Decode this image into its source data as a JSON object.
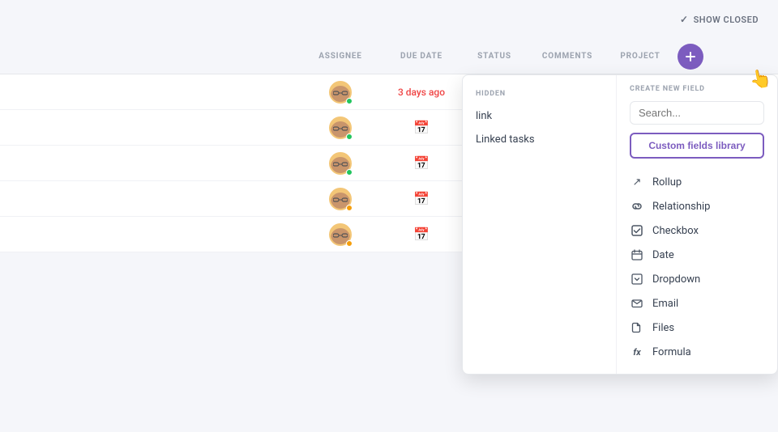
{
  "topbar": {
    "show_closed_label": "SHOW CLOSED"
  },
  "table": {
    "columns": {
      "assignee": "ASSIGNEE",
      "due_date": "DUE DATE",
      "status": "STATUS",
      "comments": "COMMENTS",
      "project": "PROJECT"
    },
    "rows": [
      {
        "due_date": "3 days ago",
        "due_date_color": "#ef4444",
        "has_status_dot": "green"
      },
      {
        "due_date": "",
        "has_status_dot": "green"
      },
      {
        "due_date": "",
        "has_status_dot": "green"
      },
      {
        "due_date": "",
        "has_status_dot": ""
      },
      {
        "due_date": "",
        "has_status_dot": ""
      }
    ]
  },
  "dropdown": {
    "hidden_section_label": "HIDDEN",
    "create_section_label": "CREATE NEW FIELD",
    "hidden_items": [
      {
        "label": "link"
      },
      {
        "label": "Linked tasks"
      }
    ],
    "search_placeholder": "Search...",
    "custom_fields_btn": "Custom fields library",
    "field_items": [
      {
        "label": "Rollup",
        "icon": "↗"
      },
      {
        "label": "Relationship",
        "icon": "🔗"
      },
      {
        "label": "Checkbox",
        "icon": "☑"
      },
      {
        "label": "Date",
        "icon": "📅"
      },
      {
        "label": "Dropdown",
        "icon": "⊟"
      },
      {
        "label": "Email",
        "icon": "✉"
      },
      {
        "label": "Files",
        "icon": "📎"
      },
      {
        "label": "Formula",
        "icon": "fx"
      }
    ]
  }
}
